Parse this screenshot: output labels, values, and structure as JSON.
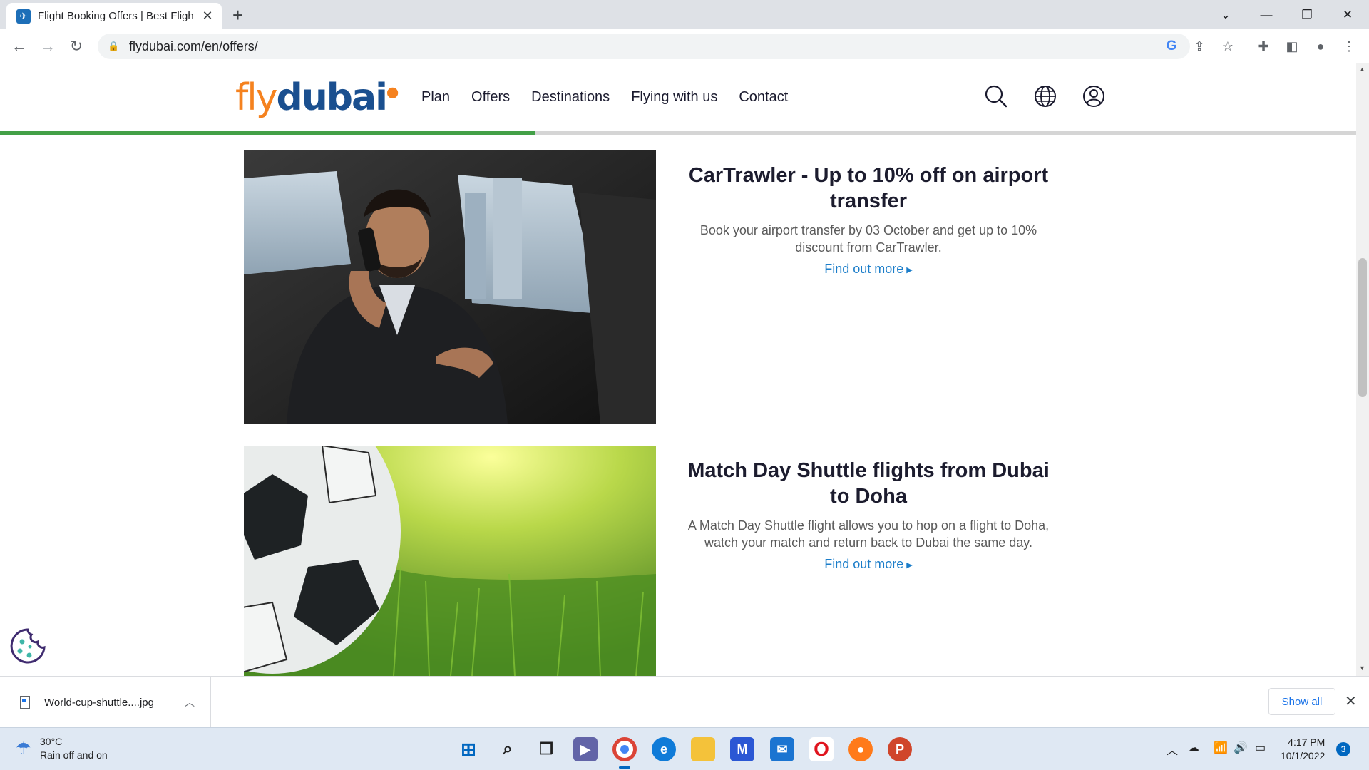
{
  "browser": {
    "tab_title": "Flight Booking Offers | Best Fligh",
    "url": "flydubai.com/en/offers/"
  },
  "site": {
    "logo_fly": "fly",
    "logo_dubai": "dubai",
    "nav": [
      "Plan",
      "Offers",
      "Destinations",
      "Flying with us",
      "Contact"
    ],
    "progress_percent": 39.5
  },
  "offers": [
    {
      "title": "CarTrawler - Up to 10% off on airport transfer",
      "description": "Book your airport transfer by 03 October and get up to 10% discount from CarTrawler.",
      "link": "Find out more",
      "image": "man-in-car-on-phone-photo"
    },
    {
      "title": "Match Day Shuttle flights from Dubai to Doha",
      "description": "A Match Day Shuttle flight allows you to hop on a flight to Doha, watch your match and return back to Dubai the same day.",
      "link": "Find out more",
      "image": "football-on-grass-photo"
    }
  ],
  "downloads": {
    "file_name": "World-cup-shuttle....jpg",
    "show_all": "Show all"
  },
  "taskbar": {
    "weather_temp": "30°C",
    "weather_desc": "Rain off and on",
    "time": "4:17 PM",
    "date": "10/1/2022",
    "notifications": "3"
  },
  "colors": {
    "brand_orange": "#f5821f",
    "brand_navy": "#1a4f8f",
    "link_blue": "#1b7dc9",
    "progress_green": "#43a047"
  }
}
